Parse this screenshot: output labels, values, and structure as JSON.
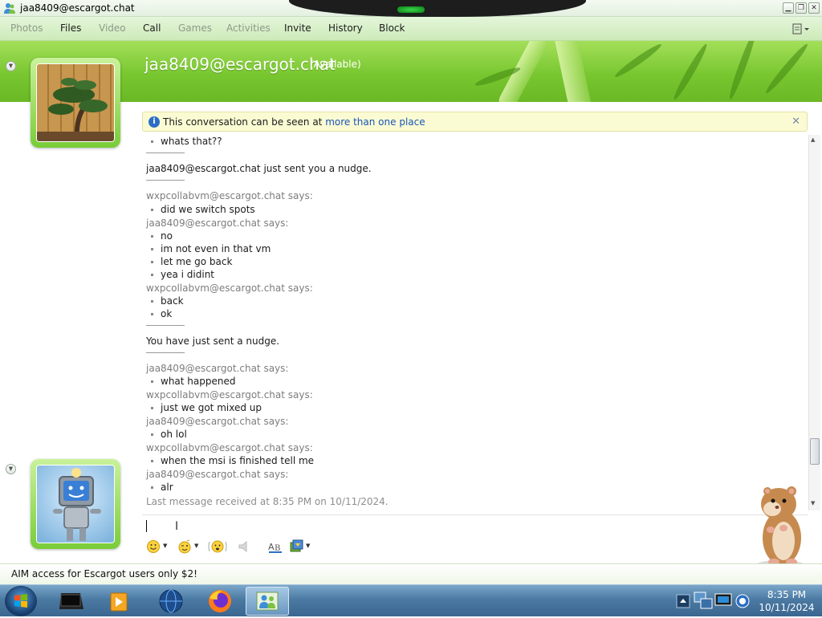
{
  "window": {
    "title": "jaa8409@escargot.chat"
  },
  "menu": {
    "items": [
      {
        "label": "Photos",
        "enabled": false
      },
      {
        "label": "Files",
        "enabled": true
      },
      {
        "label": "Video",
        "enabled": false
      },
      {
        "label": "Call",
        "enabled": true
      },
      {
        "label": "Games",
        "enabled": false
      },
      {
        "label": "Activities",
        "enabled": false
      },
      {
        "label": "Invite",
        "enabled": true
      },
      {
        "label": "History",
        "enabled": true
      },
      {
        "label": "Block",
        "enabled": true
      }
    ]
  },
  "contact": {
    "name": "jaa8409@escargot.chat",
    "status": "(Available)"
  },
  "infobar": {
    "text": "This conversation can be seen at ",
    "link": "more than one place"
  },
  "conversation": {
    "lines": [
      {
        "kind": "bullet",
        "text": "whats that??"
      },
      {
        "kind": "divider"
      },
      {
        "kind": "system",
        "text": "jaa8409@escargot.chat just sent you a nudge."
      },
      {
        "kind": "divider"
      },
      {
        "kind": "says",
        "text": "wxpcollabvm@escargot.chat says:"
      },
      {
        "kind": "bullet",
        "text": "did we switch spots"
      },
      {
        "kind": "says",
        "text": "jaa8409@escargot.chat says:"
      },
      {
        "kind": "bullet",
        "text": "no"
      },
      {
        "kind": "bullet",
        "text": "im not even in that vm"
      },
      {
        "kind": "bullet",
        "text": "let me go back"
      },
      {
        "kind": "bullet",
        "text": "yea i didint"
      },
      {
        "kind": "says",
        "text": "wxpcollabvm@escargot.chat says:"
      },
      {
        "kind": "bullet",
        "text": "back"
      },
      {
        "kind": "bullet",
        "text": "ok"
      },
      {
        "kind": "divider"
      },
      {
        "kind": "system",
        "text": "You have just sent a nudge."
      },
      {
        "kind": "divider"
      },
      {
        "kind": "says",
        "text": "jaa8409@escargot.chat says:"
      },
      {
        "kind": "bullet",
        "text": "what happened"
      },
      {
        "kind": "says",
        "text": "wxpcollabvm@escargot.chat says:"
      },
      {
        "kind": "bullet",
        "text": "just we got mixed up"
      },
      {
        "kind": "says",
        "text": "jaa8409@escargot.chat says:"
      },
      {
        "kind": "bullet",
        "text": "oh lol"
      },
      {
        "kind": "says",
        "text": "wxpcollabvm@escargot.chat says:"
      },
      {
        "kind": "bullet",
        "text": "when the msi is finished tell me"
      },
      {
        "kind": "says",
        "text": "jaa8409@escargot.chat says:"
      },
      {
        "kind": "bullet",
        "text": "alr"
      },
      {
        "kind": "last",
        "text": "Last message received at 8:35 PM on 10/11/2024."
      }
    ]
  },
  "input": {
    "value": ""
  },
  "toolbar": {
    "icons": [
      "emoticon-icon",
      "wink-icon",
      "nudge-icon",
      "voice-clip-icon",
      "font-icon",
      "background-icon"
    ]
  },
  "footer": {
    "ad_text": "AIM access for Escargot users only $2!"
  },
  "taskbar": {
    "time": "8:35 PM",
    "date": "10/11/2024",
    "apps": [
      "terminal-icon",
      "media-player-icon",
      "globe-browser-icon",
      "firefox-icon",
      "messenger-icon"
    ]
  },
  "colors": {
    "banner": "#78c730",
    "link": "#1a55b8",
    "menu_disabled": "#8c9a88",
    "infobar_bg": "#fbfbd3",
    "taskbar": "#4b7aa3"
  }
}
